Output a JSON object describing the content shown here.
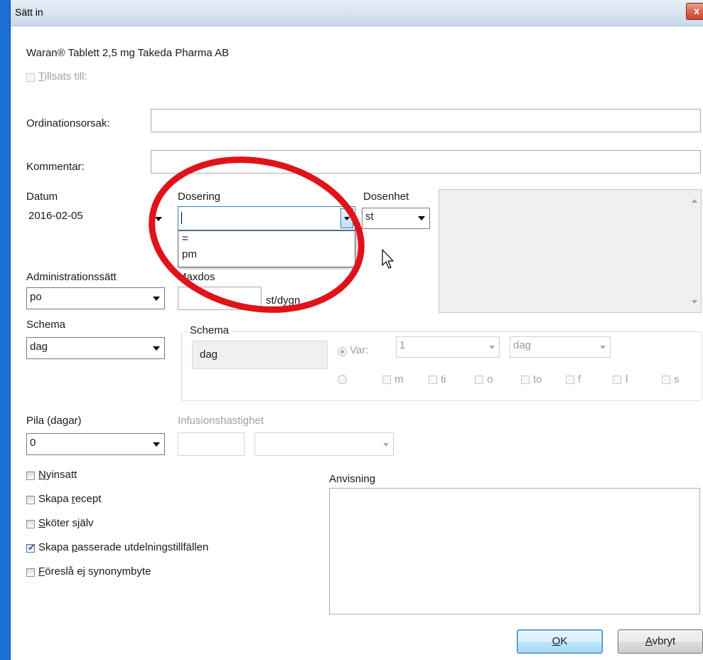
{
  "window": {
    "title": "Sätt in",
    "close_glyph": "x"
  },
  "product_name": "Waran® Tablett 2,5 mg Takeda Pharma AB",
  "additive": {
    "label_u": "T",
    "label_rest": "illsats till:",
    "checked": false
  },
  "fields": {
    "ordination_label": "Ordinationsorsak:",
    "ordination_value": "",
    "comment_label": "Kommentar:",
    "comment_value": ""
  },
  "date": {
    "label": "Datum",
    "value": "2016-02-05"
  },
  "dosage": {
    "label": "Dosering",
    "value": "",
    "options": [
      "=",
      "pm"
    ]
  },
  "dose_unit": {
    "label": "Dosenhet",
    "value": "st"
  },
  "administration": {
    "label": "Administrationssätt",
    "value": "po"
  },
  "maxdos": {
    "label": "Maxdos",
    "value": "",
    "unit": "st/dygn"
  },
  "schema_select": {
    "label": "Schema",
    "value": "dag"
  },
  "schema_group": {
    "legend": "Schema",
    "summary": "dag",
    "var_label": "Var:",
    "interval_value": "1",
    "period_value": "dag",
    "days": [
      "m",
      "ti",
      "o",
      "to",
      "f",
      "l",
      "s"
    ]
  },
  "pila": {
    "label": "Pila (dagar)",
    "value": "0"
  },
  "infusion": {
    "label": "Infusionshastighet",
    "value": "",
    "unit_value": ""
  },
  "checkboxes": [
    {
      "pre": "",
      "u": "N",
      "post": "yinsatt",
      "checked": false
    },
    {
      "pre": "Skapa ",
      "u": "r",
      "post": "ecept",
      "checked": false
    },
    {
      "pre": "",
      "u": "S",
      "post": "köter själv",
      "checked": false
    },
    {
      "pre": "Skapa ",
      "u": "p",
      "post": "asserade utdelningstillfällen",
      "checked": true
    },
    {
      "pre": "",
      "u": "F",
      "post": "öreslå ej synonymbyte",
      "checked": false
    }
  ],
  "instruction": {
    "label_pre": "Anvisnin",
    "label_u": "g",
    "value": ""
  },
  "buttons": {
    "ok_u": "O",
    "ok_rest": "K",
    "cancel_u": "A",
    "cancel_rest": "vbryt"
  },
  "colors": {
    "highlight_circle": "#e0121a",
    "title_bg": "#d5e2f0",
    "check_tick": "#2a4f9e"
  }
}
